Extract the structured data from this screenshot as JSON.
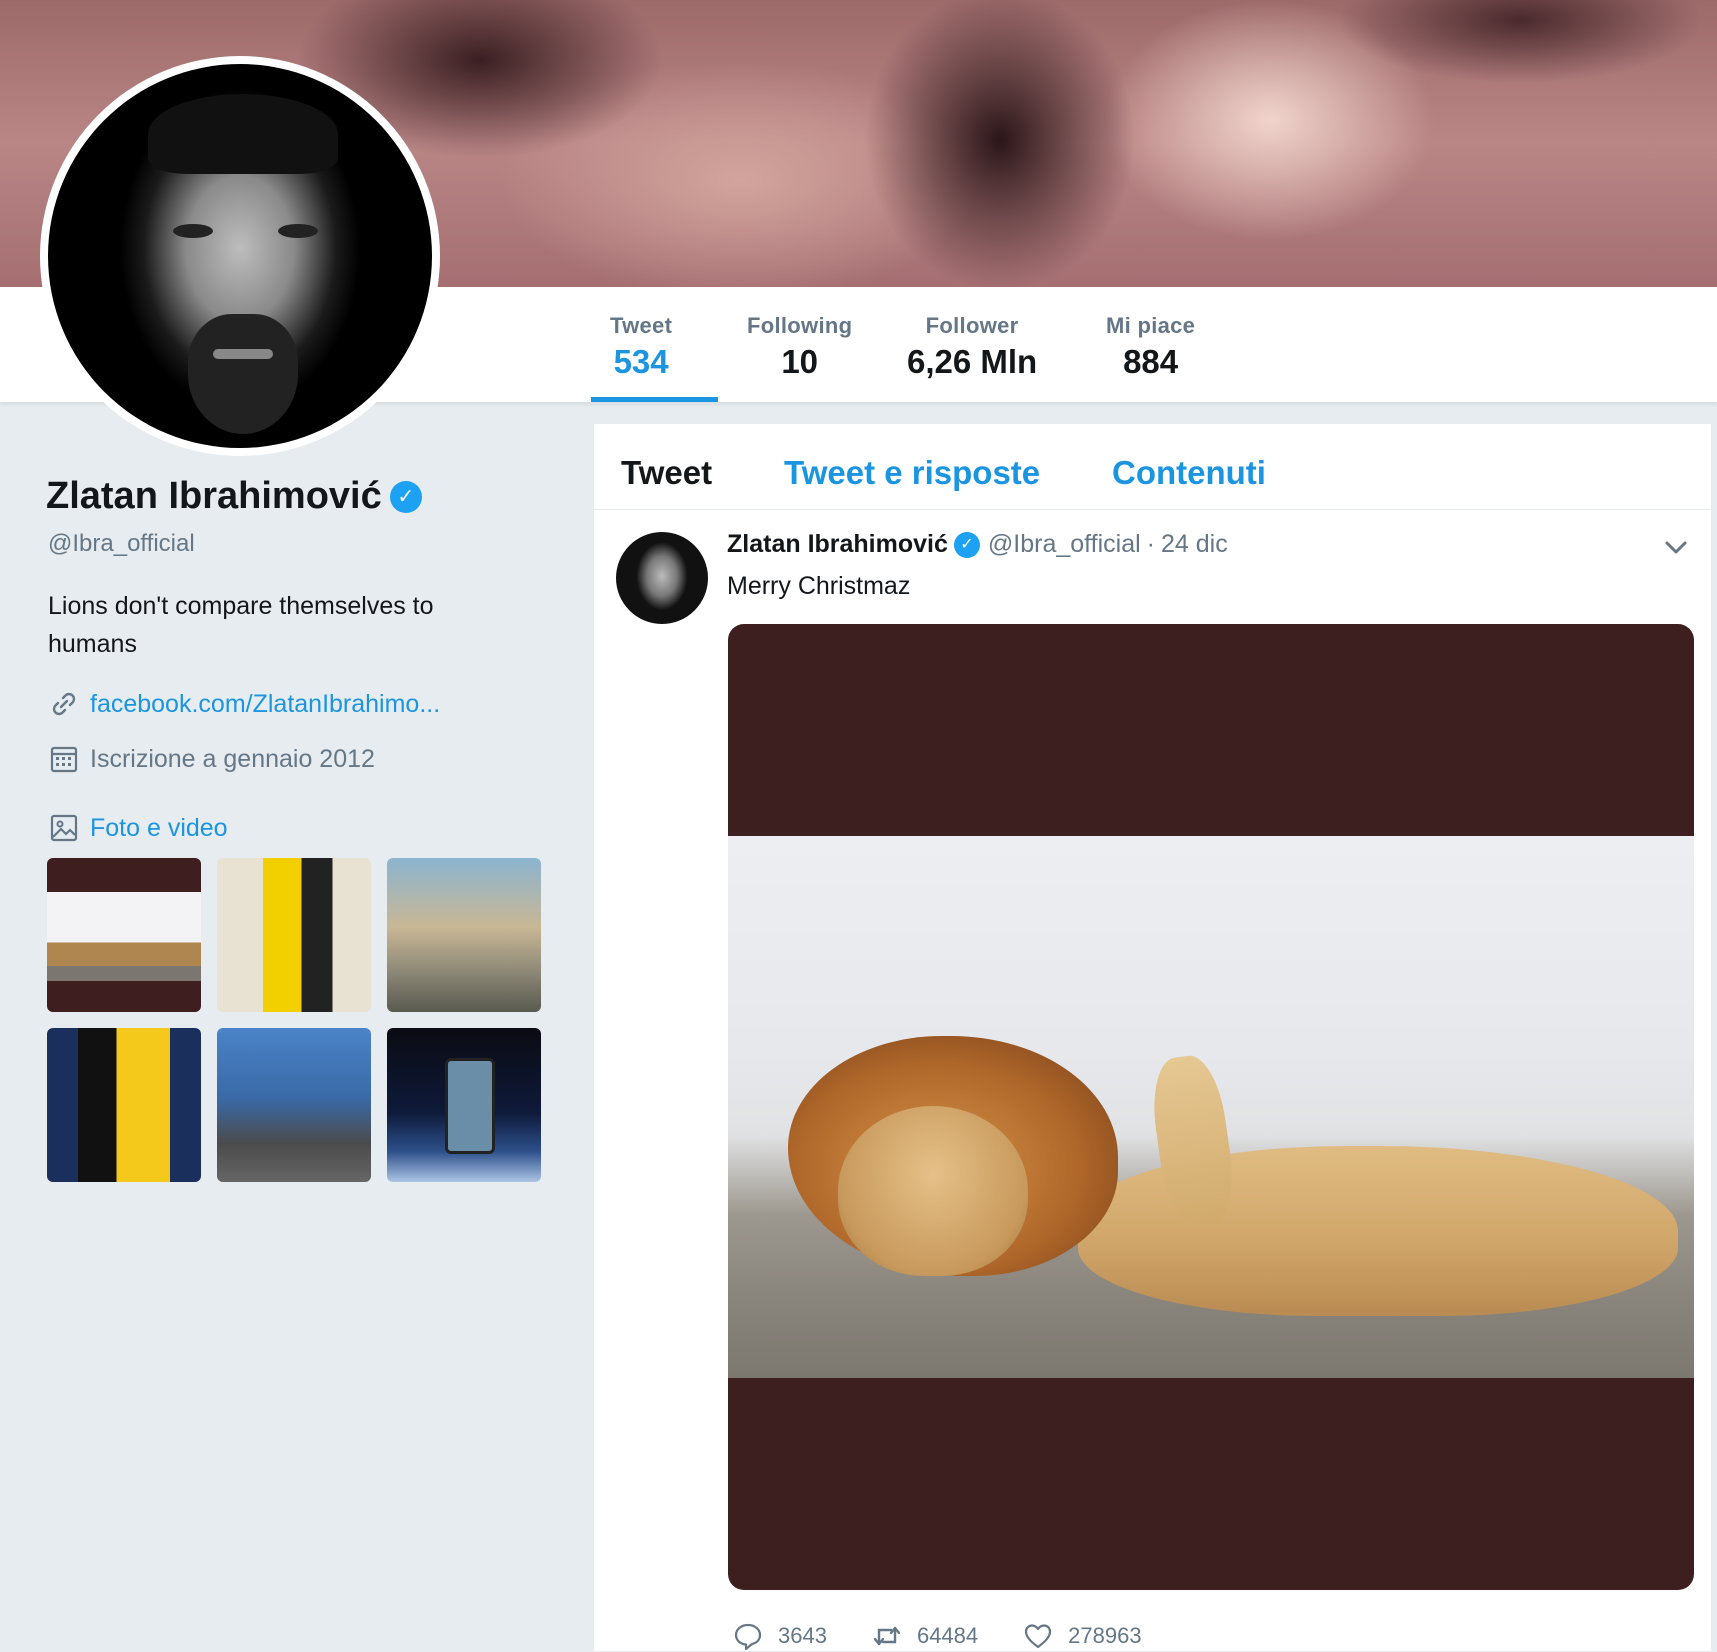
{
  "profile": {
    "name": "Zlatan Ibrahimović",
    "handle": "@Ibra_official",
    "bio": "Lions don't compare themselves to humans",
    "link": "facebook.com/ZlatanIbrahimo...",
    "joined": "Iscrizione a gennaio 2012",
    "media_label": "Foto e video",
    "verified_icon": "verified-badge-icon"
  },
  "stats": [
    {
      "label": "Tweet",
      "value": "534"
    },
    {
      "label": "Following",
      "value": "10"
    },
    {
      "label": "Follower",
      "value": "6,26 Mln"
    },
    {
      "label": "Mi piace",
      "value": "884"
    }
  ],
  "tabs": [
    "Tweet",
    "Tweet e risposte",
    "Contenuti"
  ],
  "tweet": {
    "name": "Zlatan Ibrahimović",
    "handle": "@Ibra_official",
    "separator": "·",
    "date": "24 dic",
    "text": "Merry Christmaz",
    "replies": "3643",
    "retweets": "64484",
    "likes": "278963"
  },
  "colors": {
    "accent": "#1b95e0",
    "verified": "#1da1f2",
    "background": "#e6ecf0",
    "muted": "#657786"
  }
}
